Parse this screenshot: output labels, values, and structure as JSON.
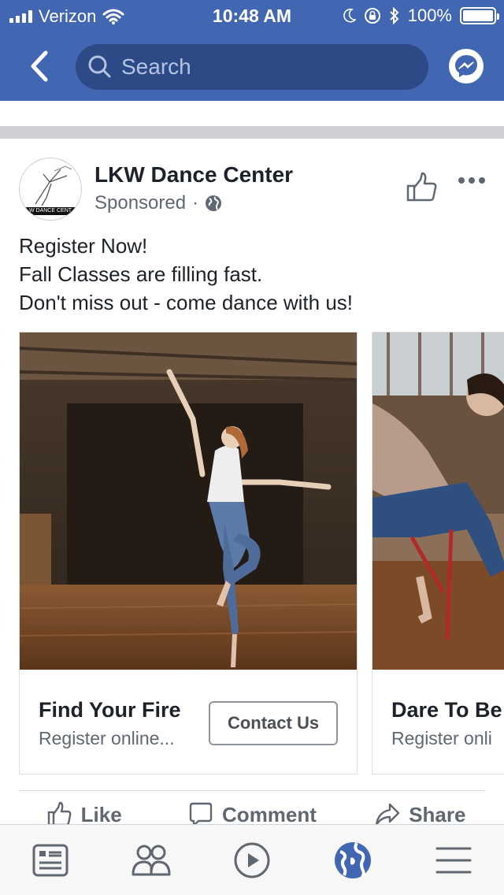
{
  "status_bar": {
    "carrier": "Verizon",
    "time": "10:48 AM",
    "battery": "100%"
  },
  "nav": {
    "search_placeholder": "Search"
  },
  "post": {
    "page_name": "LKW Dance Center",
    "sponsored": "Sponsored",
    "avatar_text": "W DANCE CENT",
    "text_lines": [
      "Register Now!",
      "Fall Classes are filling fast.",
      "Don't miss out - come dance with us!"
    ],
    "cards": [
      {
        "headline": "Find Your Fire",
        "description": "Register online...",
        "cta": "Contact Us"
      },
      {
        "headline": "Dare To Be",
        "description": "Register onli"
      }
    ],
    "actions": {
      "like": "Like",
      "comment": "Comment",
      "share": "Share"
    }
  },
  "tabs": [
    {
      "icon": "news-feed-icon"
    },
    {
      "icon": "friends-icon"
    },
    {
      "icon": "watch-icon"
    },
    {
      "icon": "globe-icon",
      "active": true
    },
    {
      "icon": "menu-icon"
    }
  ],
  "colors": {
    "brand": "#4267b2",
    "search_bg": "#2d4a86",
    "active_tab": "#4267b2",
    "text_primary": "#1d2129",
    "text_secondary": "#606770"
  }
}
